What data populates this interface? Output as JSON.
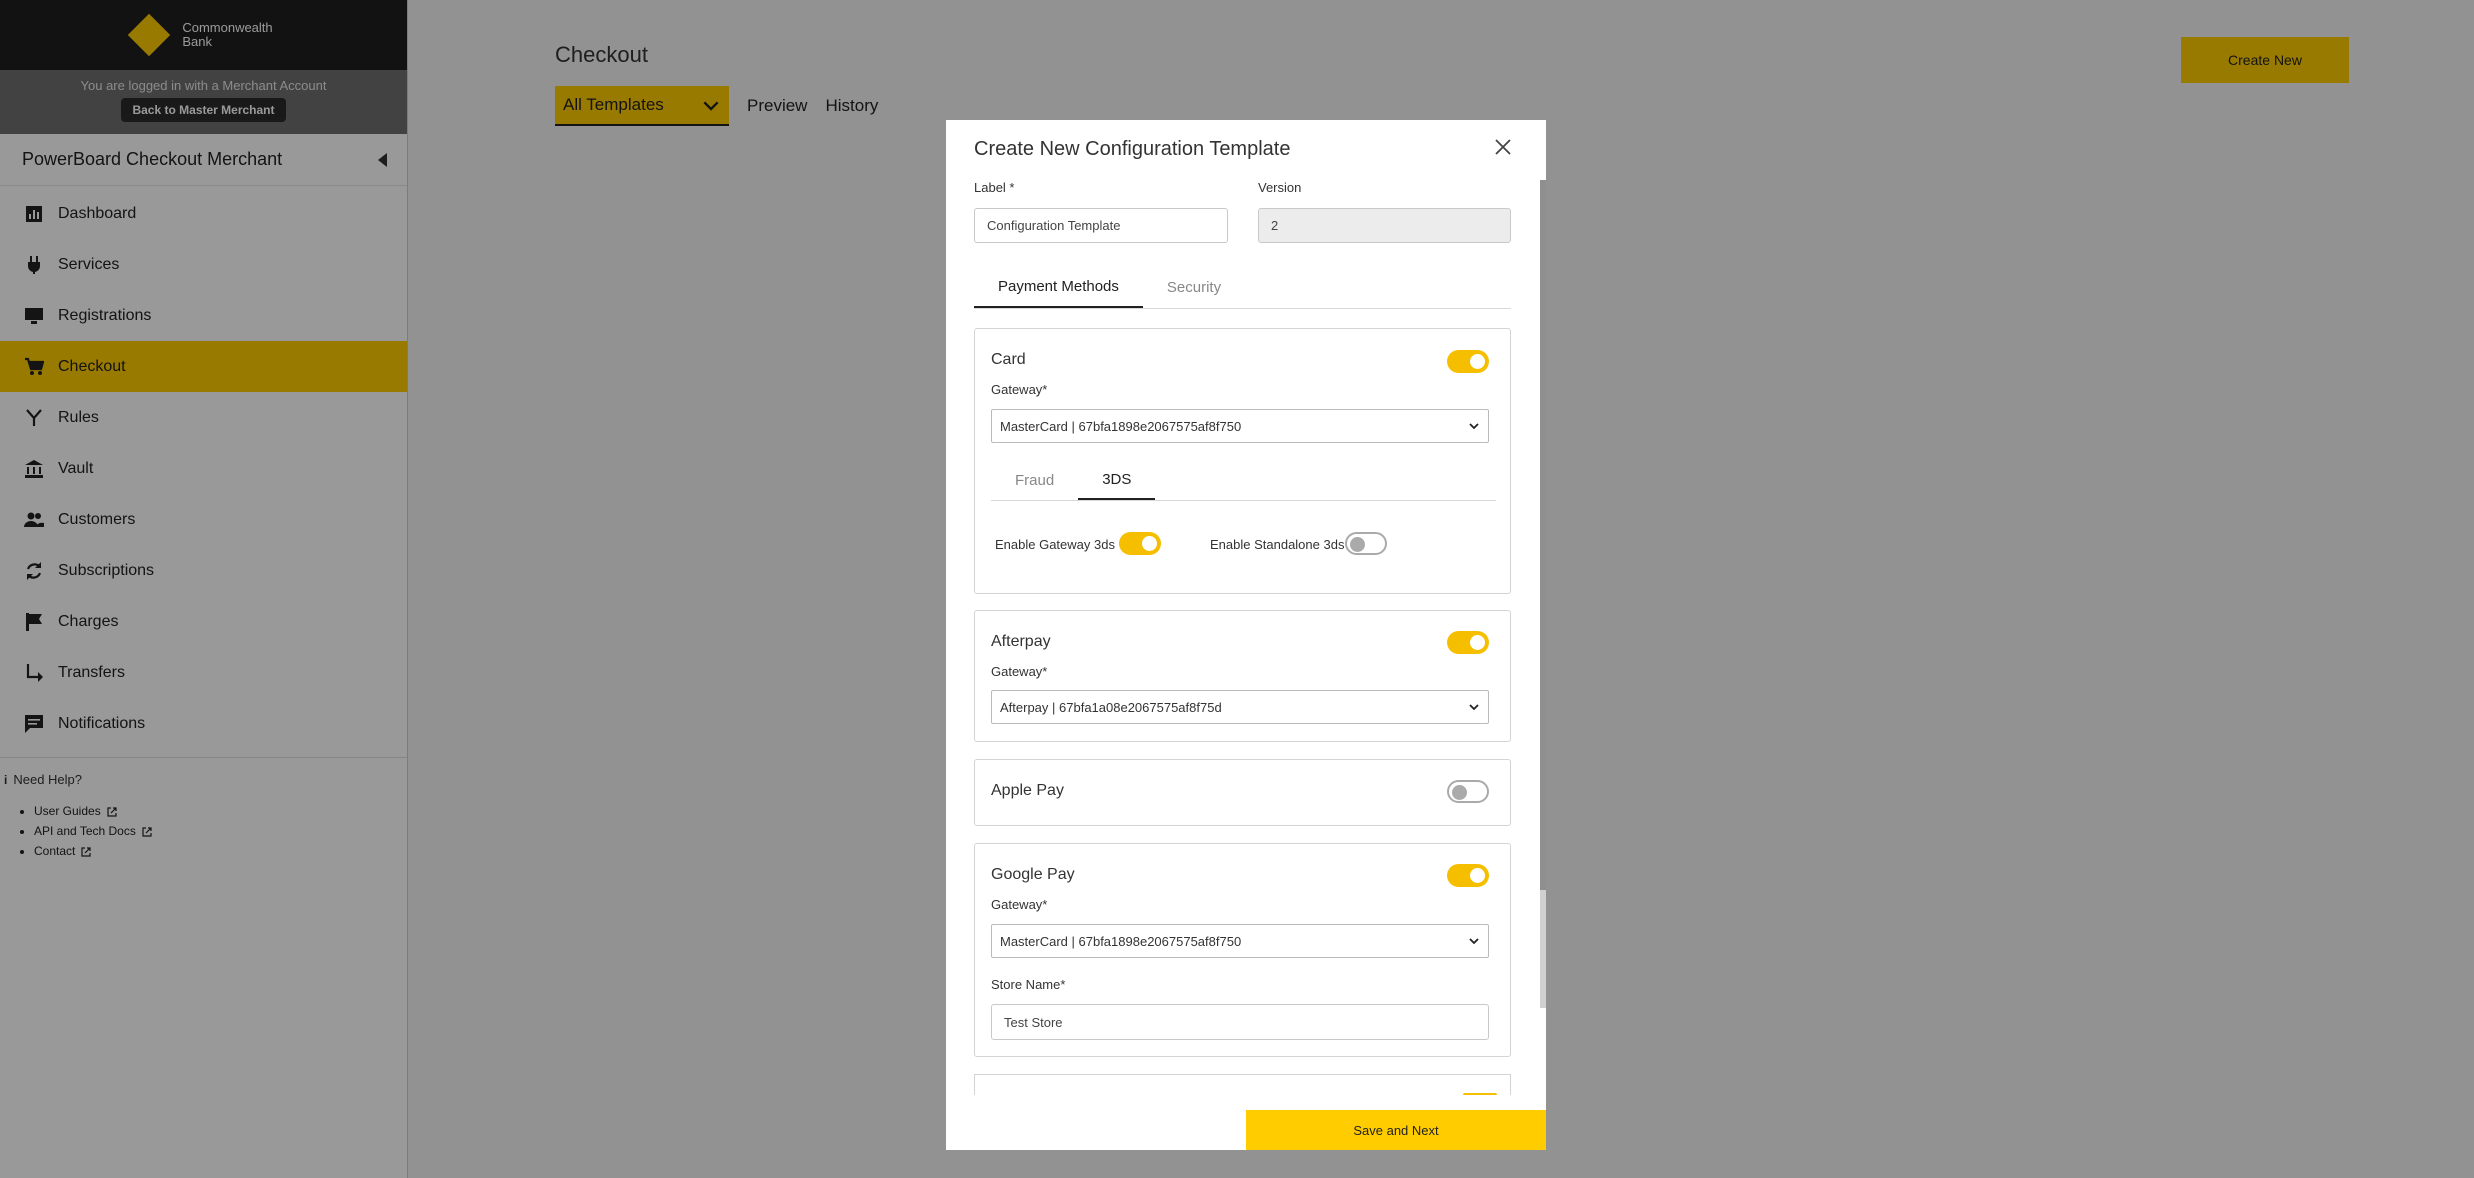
{
  "brand": {
    "name_line1": "Commonwealth",
    "name_line2": "Bank"
  },
  "merchant": {
    "info": "You are logged in with a Merchant Account",
    "back_label": "Back to Master Merchant",
    "title": "PowerBoard Checkout Merchant"
  },
  "nav": [
    {
      "label": "Dashboard",
      "icon": "chart-icon"
    },
    {
      "label": "Services",
      "icon": "plug-icon"
    },
    {
      "label": "Registrations",
      "icon": "monitor-icon"
    },
    {
      "label": "Checkout",
      "icon": "cart-icon",
      "active": true
    },
    {
      "label": "Rules",
      "icon": "fork-icon"
    },
    {
      "label": "Vault",
      "icon": "bank-icon"
    },
    {
      "label": "Customers",
      "icon": "people-icon"
    },
    {
      "label": "Subscriptions",
      "icon": "refresh-icon"
    },
    {
      "label": "Charges",
      "icon": "flag-icon"
    },
    {
      "label": "Transfers",
      "icon": "arrow-turn-icon"
    },
    {
      "label": "Notifications",
      "icon": "chat-icon"
    }
  ],
  "help": {
    "title": "Need Help?",
    "links": [
      "User Guides",
      "API and Tech Docs",
      "Contact"
    ]
  },
  "page": {
    "title": "Checkout",
    "template_select": "All Templates",
    "tabs": [
      "Preview",
      "History"
    ],
    "create_label": "Create New"
  },
  "modal": {
    "title": "Create New Configuration Template",
    "label_label": "Label *",
    "label_value": "Configuration Template",
    "version_label": "Version",
    "version_value": "2",
    "tabs": [
      "Payment Methods",
      "Security"
    ],
    "save_label": "Save and Next"
  },
  "card": {
    "name": "Card",
    "gateway_label": "Gateway*",
    "gateway_value": "MasterCard | 67bfa1898e2067575af8f750",
    "tabs": [
      "Fraud",
      "3DS"
    ],
    "gateway3ds_label": "Enable Gateway 3ds",
    "standalone3ds_label": "Enable Standalone 3ds"
  },
  "afterpay": {
    "name": "Afterpay",
    "gateway_label": "Gateway*",
    "gateway_value": "Afterpay | 67bfa1a08e2067575af8f75d"
  },
  "applepay": {
    "name": "Apple Pay"
  },
  "googlepay": {
    "name": "Google Pay",
    "gateway_label": "Gateway*",
    "gateway_value": "MasterCard | 67bfa1898e2067575af8f750",
    "store_label": "Store Name*",
    "store_value": "Test Store"
  },
  "colors": {
    "accent": "#ffcc00",
    "toggle_on": "#f5bf00",
    "sidebar_dark": "#1e1e1e"
  }
}
